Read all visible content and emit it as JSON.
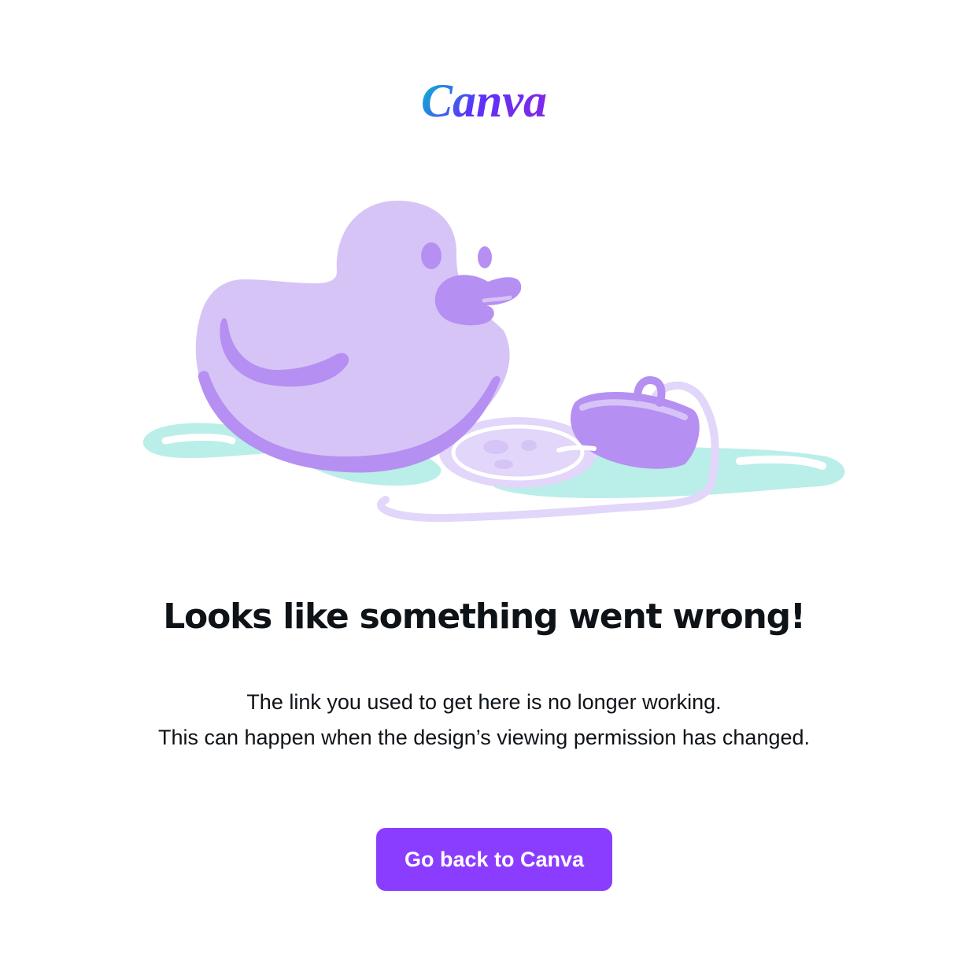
{
  "brand": {
    "logo_text": "Canva",
    "gradient_start": "#00c4cc",
    "gradient_mid": "#5a32fa",
    "gradient_end": "#7d2ae8"
  },
  "illustration": {
    "subject": "rubber-duck-with-drain-plug-in-puddle",
    "colors": {
      "duck_body": "#d6c4f7",
      "duck_shadow": "#b68ff2",
      "water": "#baeee9",
      "drain": "#e2d6fa",
      "plug": "#b68ff2"
    }
  },
  "error": {
    "title": "Looks like something went wrong!",
    "message_line_1": "The link you used to get here is no longer working.",
    "message_line_2": "This can happen when the design’s viewing permission has changed."
  },
  "actions": {
    "back_label": "Go back to Canva",
    "button_color": "#8b3dff"
  }
}
